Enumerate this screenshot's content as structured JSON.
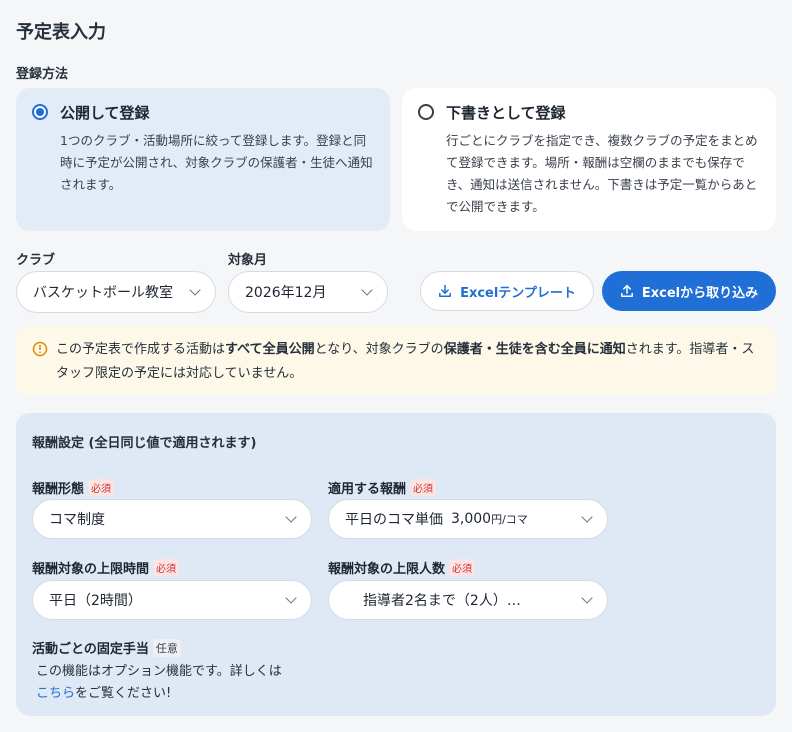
{
  "page_title": "予定表入力",
  "registration": {
    "label": "登録方法",
    "options": [
      {
        "title": "公開して登録",
        "desc": "1つのクラブ・活動場所に絞って登録します。登録と同時に予定が公開され、対象クラブの保護者・生徒へ通知されます。",
        "selected": true
      },
      {
        "title": "下書きとして登録",
        "desc": "行ごとにクラブを指定でき、複数クラブの予定をまとめて登録できます。場所・報酬は空欄のままでも保存でき、通知は送信されません。下書きは予定一覧からあとで公開できます。",
        "selected": false
      }
    ]
  },
  "filters": {
    "club_label": "クラブ",
    "club_value": "バスケットボール教室",
    "month_label": "対象月",
    "month_value": "2026年12月"
  },
  "actions": {
    "template_label": "Excelテンプレート",
    "import_label": "Excelから取り込み"
  },
  "notice": {
    "t1": "この予定表で作成する活動は",
    "b1": "すべて全員公開",
    "t2": "となり、対象クラブの",
    "b2": "保護者・生徒を含む全員に通知",
    "t3": "されます。指導者・スタッフ限定の予定には対応していません。"
  },
  "reward": {
    "title": "報酬設定 (全日同じ値で適用されます)",
    "required_badge": "必須",
    "optional_badge": "任意",
    "type_label": "報酬形態",
    "type_value": "コマ制度",
    "applied_label": "適用する報酬",
    "applied_value": "平日のコマ単価",
    "applied_amount": "3,000",
    "applied_unit": "円/コマ",
    "hours_label": "報酬対象の上限時間",
    "hours_value": "平日（2時間）",
    "people_label": "報酬対象の上限人数",
    "people_value": "指導者2名まで（2人）…",
    "allowance_label": "活動ごとの固定手当",
    "allowance_text1": "この機能はオプション機能です。詳しくは",
    "allowance_link": "こちら",
    "allowance_text2": "をご覧ください!"
  },
  "colors": {
    "accent": "#1f6fd6",
    "selected_card": "#e3ebf7",
    "notice_bg": "#fdf8e8",
    "panel_bg": "#dfe8f5",
    "required": "#d32f2f"
  }
}
